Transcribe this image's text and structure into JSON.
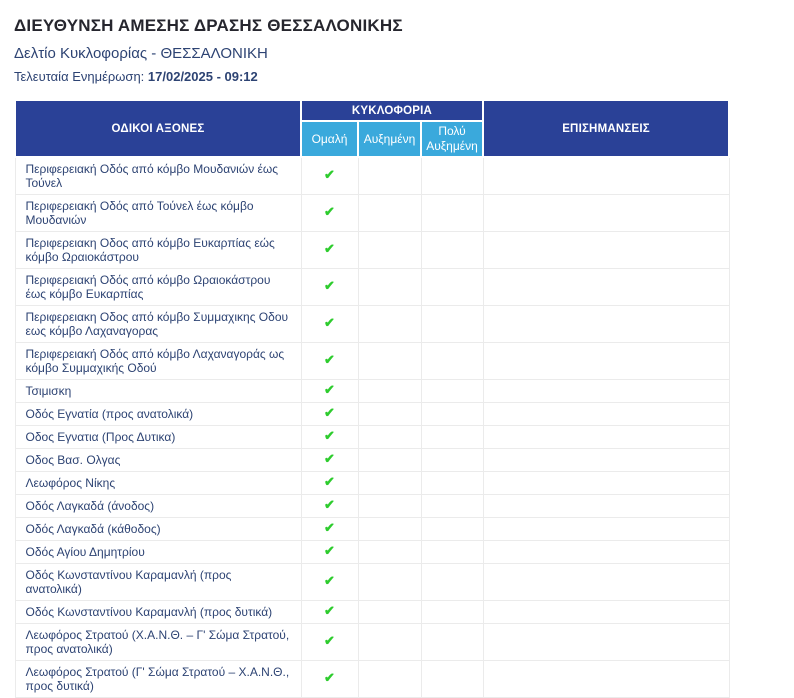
{
  "page": {
    "title": "ΔΙΕΥΘΥΝΣΗ ΑΜΕΣΗΣ ΔΡΑΣΗΣ ΘΕΣΣΑΛΟΝΙΚΗΣ",
    "subtitle": "Δελτίο Κυκλοφορίας - ΘΕΣΣΑΛΟΝΙΚΗ",
    "last_update_label": "Τελευταία Ενημέρωση: ",
    "last_update_value": "17/02/2025 - 09:12"
  },
  "colors": {
    "header_navy": "#2a4197",
    "header_light_blue": "#3aa9dc",
    "check_green": "#2ecc2e",
    "body_text": "#2d4373"
  },
  "table": {
    "col_roads": "ΟΔΙΚΟΙ ΑΞΟΝΕΣ",
    "col_traffic": "ΚΥΚΛΟΦΟΡΙΑ",
    "col_notes": "ΕΠΙΣΗΜΑΝΣΕΙΣ",
    "traffic_levels": [
      "Ομαλή",
      "Αυξημένη",
      "Πολύ Αυξημένη"
    ],
    "check_icon": "✔",
    "rows": [
      {
        "road": "Περιφερειακή Οδός από κόμβο Μουδανιών έως Τούνελ",
        "status": "normal",
        "notes": ""
      },
      {
        "road": "Περιφερειακή Οδός από Τούνελ έως κόμβο Μουδανιών",
        "status": "normal",
        "notes": ""
      },
      {
        "road": "Περιφερειακη Οδος από κόμβο Ευκαρπίας εώς κόμβο Ωραιοκάστρου",
        "status": "normal",
        "notes": ""
      },
      {
        "road": "Περιφερειακή Οδός από κόμβο Ωραιοκάστρου έως κόμβο Ευκαρπίας",
        "status": "normal",
        "notes": ""
      },
      {
        "road": "Περιφερειακη Οδος από κόμβο Συμμαχικης Οδου εως κόμβο Λαχαναγορας",
        "status": "normal",
        "notes": ""
      },
      {
        "road": "Περιφερειακή Οδός από κόμβο Λαχαναγοράς ως κόμβο Συμμαχικής Οδού",
        "status": "normal",
        "notes": ""
      },
      {
        "road": "Τσιμισκη",
        "status": "normal",
        "notes": ""
      },
      {
        "road": "Οδός Εγνατία (προς ανατολικά)",
        "status": "normal",
        "notes": ""
      },
      {
        "road": "Οδος Εγνατια (Προς Δυτικα)",
        "status": "normal",
        "notes": ""
      },
      {
        "road": "Οδος Βασ. Ολγας",
        "status": "normal",
        "notes": ""
      },
      {
        "road": "Λεωφόρος Νίκης",
        "status": "normal",
        "notes": ""
      },
      {
        "road": "Οδός Λαγκαδά (άνοδος)",
        "status": "normal",
        "notes": ""
      },
      {
        "road": "Οδός Λαγκαδά (κάθοδος)",
        "status": "normal",
        "notes": ""
      },
      {
        "road": "Οδός Αγίου Δημητρίου",
        "status": "normal",
        "notes": ""
      },
      {
        "road": "Οδός Κωνσταντίνου Καραμανλή (προς ανατολικά)",
        "status": "normal",
        "notes": ""
      },
      {
        "road": "Οδός Κωνσταντίνου Καραμανλή (προς δυτικά)",
        "status": "normal",
        "notes": ""
      },
      {
        "road": "Λεωφόρος Στρατού (Χ.Α.Ν.Θ. – Γ' Σώμα Στρατού, προς ανατολικά)",
        "status": "normal",
        "notes": ""
      },
      {
        "road": "Λεωφόρος Στρατού (Γ' Σώμα Στρατού – Χ.Α.Ν.Θ., προς δυτικά)",
        "status": "normal",
        "notes": ""
      }
    ]
  }
}
